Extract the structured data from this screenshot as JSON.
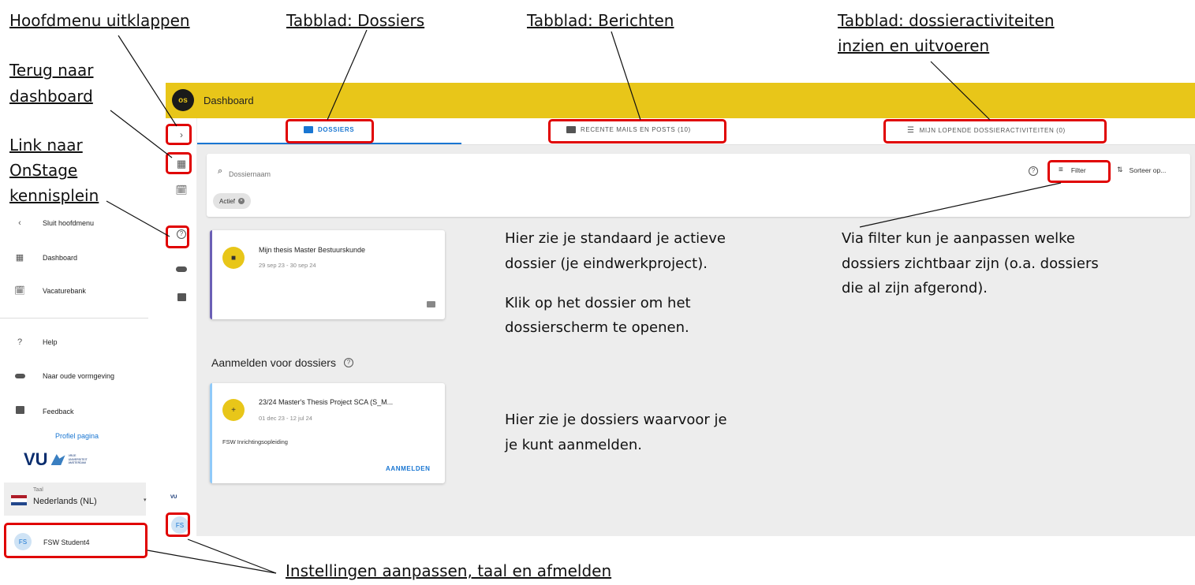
{
  "annotations": {
    "hoofdmenu": "Hoofdmenu uitklappen",
    "dossiers_tab": "Tabblad: Dossiers",
    "berichten_tab": "Tabblad: Berichten",
    "activiteiten_tab_line1": "Tabblad: dossieractiviteiten",
    "activiteiten_tab_line2": "inzien en uitvoeren",
    "terug_line1": "Terug naar",
    "terug_line2": "dashboard",
    "link_line1": "Link naar",
    "link_line2": "OnStage",
    "link_line3": "kennisplein",
    "actief_line1": "Hier zie je standaard je actieve",
    "actief_line2": "dossier (je eindwerkproject).",
    "klik_line1": "Klik op het dossier om het",
    "klik_line2": "dossierscherm te openen.",
    "filter_line1": "Via filter kun je aanpassen welke",
    "filter_line2": "dossiers zichtbaar zijn (o.a. dossiers",
    "filter_line3": "die al zijn afgerond).",
    "aanmelden_line1": "Hier zie je dossiers waarvoor je",
    "aanmelden_line2": "je kunt aanmelden.",
    "instellingen": "Instellingen aanpassen, taal en afmelden"
  },
  "app": {
    "logo_text": "os",
    "title": "Dashboard",
    "brand_color": "#e8c619",
    "accent_color": "#1976d2"
  },
  "tabs": [
    {
      "label": "DOSSIERS",
      "icon": "folder-icon",
      "active": true
    },
    {
      "label": "RECENTE MAILS EN POSTS (10)",
      "icon": "mail-icon",
      "active": false
    },
    {
      "label": "MIJN LOPENDE DOSSIERACTIVITEITEN (0)",
      "icon": "checklist-icon",
      "active": false
    }
  ],
  "search": {
    "placeholder": "Dossiernaam",
    "filter_label": "Filter",
    "sort_label": "Sorteer op...",
    "chip_label": "Actief"
  },
  "active_dossier": {
    "title": "Mijn thesis Master Bestuurskunde",
    "dates": "29 sep 23 - 30 sep 24"
  },
  "signup_section": {
    "title": "Aanmelden voor dossiers",
    "card": {
      "title": "23/24 Master's Thesis Project SCA (S_M...",
      "dates": "01 dec 23 - 12 jul 24",
      "subtitle": "FSW Inrichtingsopleiding",
      "action": "AANMELDEN"
    }
  },
  "side_menu": {
    "close": "Sluit hoofdmenu",
    "dashboard": "Dashboard",
    "vacaturebank": "Vacaturebank",
    "help": "Help",
    "oude_vormgeving": "Naar oude vormgeving",
    "feedback": "Feedback",
    "profiel": "Profiel pagina",
    "vu_logo": "VU",
    "vu_sub": "VRIJE UNIVERSITEIT AMSTERDAM",
    "taal_label": "Taal",
    "taal_value": "Nederlands (NL)",
    "user_initials": "FS",
    "user_name": "FSW Student4"
  }
}
